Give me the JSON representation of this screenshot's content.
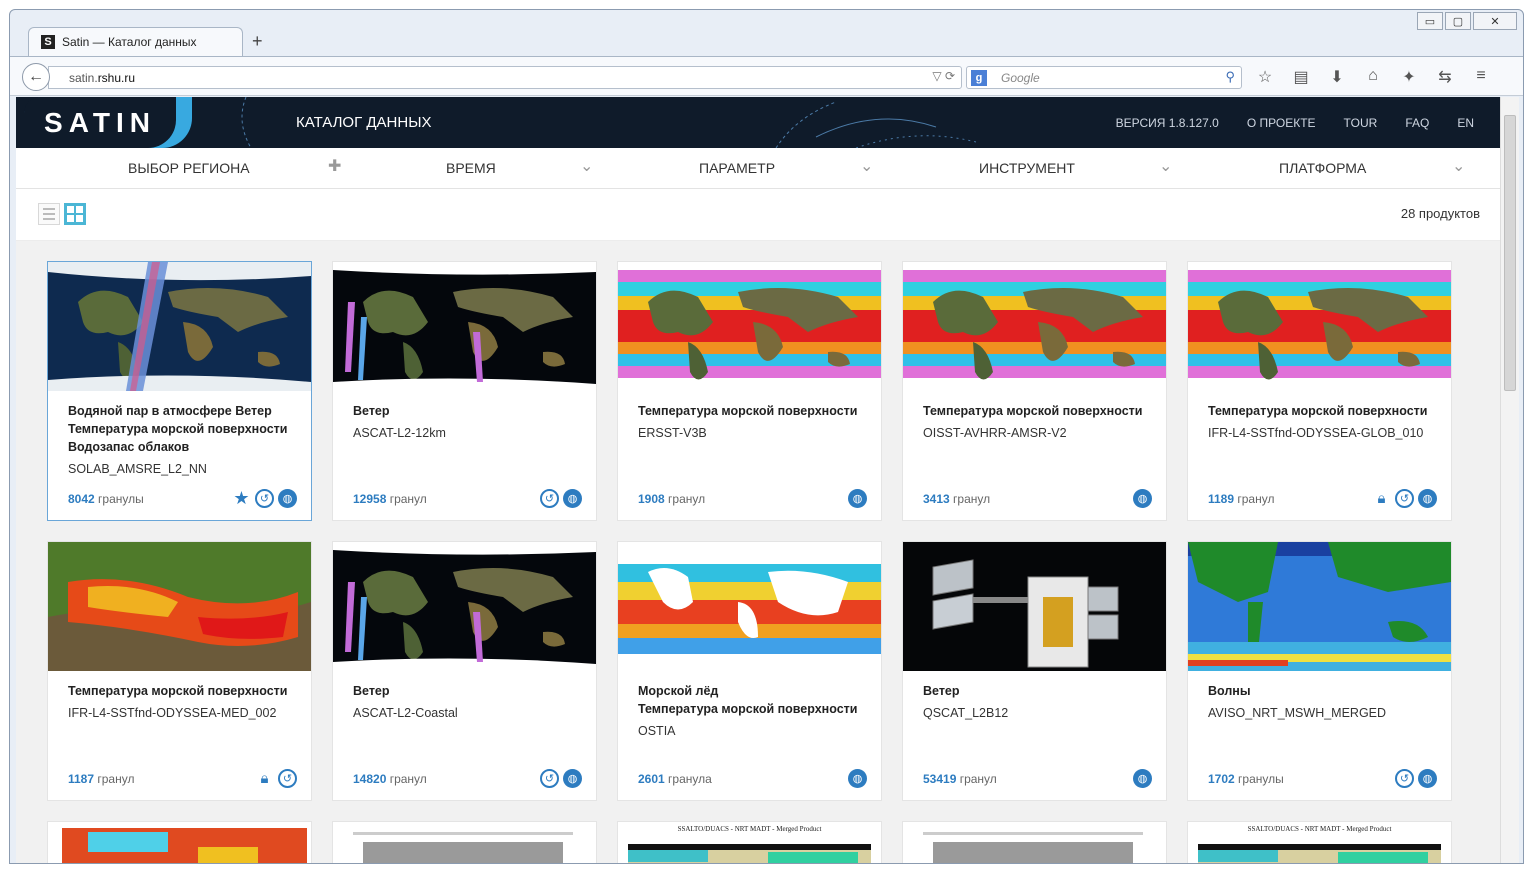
{
  "browser": {
    "tab_title": "Satin — Каталог данных",
    "tab_favicon": "S",
    "new_tab": "+",
    "url_prefix": "satin.",
    "url_domain": "rshu.ru",
    "search_placeholder": "Google",
    "search_engine": "g",
    "window_controls": [
      "▭",
      "▢",
      "✕"
    ],
    "toolbar_icons": [
      "star-icon",
      "bookmarks-icon",
      "download-icon",
      "home-icon",
      "addon-icon",
      "sync-icon",
      "menu-icon"
    ]
  },
  "header": {
    "logo": "SATIN",
    "catalog_title": "КАТАЛОГ ДАННЫХ",
    "nav": [
      "ВЕРСИЯ 1.8.127.0",
      "О ПРОЕКТЕ",
      "TOUR",
      "FAQ",
      "EN"
    ]
  },
  "filters": {
    "region": "ВЫБОР РЕГИОНА",
    "time": "ВРЕМЯ",
    "parameter": "ПАРАМЕТР",
    "instrument": "ИНСТРУМЕНТ",
    "platform": "ПЛАТФОРМА"
  },
  "toolbar": {
    "count": "28 продуктов"
  },
  "cards": [
    {
      "title": [
        "Водяной пар в атмосфере  Ветер",
        "Температура морской поверхности",
        "Водозапас облаков"
      ],
      "name": "SOLAB_AMSRE_L2_NN",
      "count": "8042",
      "unit": "гранулы",
      "icons": [
        "favorite-star-icon",
        "history-icon",
        "globe-icon"
      ],
      "image": "globe-swath"
    },
    {
      "title": [
        "Ветер"
      ],
      "name": "ASCAT-L2-12km",
      "count": "12958",
      "unit": "гранул",
      "icons": [
        "history-icon",
        "globe-icon"
      ],
      "image": "dark-swath"
    },
    {
      "title": [
        "Температура морской поверхности"
      ],
      "name": "ERSST-V3B",
      "count": "1908",
      "unit": "гранул",
      "icons": [
        "globe-icon"
      ],
      "image": "sst"
    },
    {
      "title": [
        "Температура морской поверхности"
      ],
      "name": "OISST-AVHRR-AMSR-V2",
      "count": "3413",
      "unit": "гранул",
      "icons": [
        "globe-icon"
      ],
      "image": "sst"
    },
    {
      "title": [
        "Температура морской поверхности"
      ],
      "name": "IFR-L4-SSTfnd-ODYSSEA-GLOB_010",
      "count": "1189",
      "unit": "гранул",
      "icons": [
        "lock-icon",
        "history-icon",
        "globe-icon"
      ],
      "image": "sst"
    },
    {
      "title": [
        "Температура морской поверхности"
      ],
      "name": "IFR-L4-SSTfnd-ODYSSEA-MED_002",
      "count": "1187",
      "unit": "гранул",
      "icons": [
        "lock-icon",
        "history-icon"
      ],
      "image": "med"
    },
    {
      "title": [
        "Ветер"
      ],
      "name": "ASCAT-L2-Coastal",
      "count": "14820",
      "unit": "гранул",
      "icons": [
        "history-icon",
        "globe-icon"
      ],
      "image": "dark-swath"
    },
    {
      "title": [
        "Морской лёд",
        "Температура морской поверхности"
      ],
      "name": "OSTIA",
      "count": "2601",
      "unit": "гранула",
      "icons": [
        "globe-icon"
      ],
      "image": "ostia"
    },
    {
      "title": [
        "Ветер"
      ],
      "name": "QSCAT_L2B12",
      "count": "53419",
      "unit": "гранул",
      "icons": [
        "globe-icon"
      ],
      "image": "satellite"
    },
    {
      "title": [
        "Волны"
      ],
      "name": "AVISO_NRT_MSWH_MERGED",
      "count": "1702",
      "unit": "гранулы",
      "icons": [
        "history-icon",
        "globe-icon"
      ],
      "image": "waves"
    }
  ],
  "partial_cards": [
    {
      "caption": "",
      "image": "map-red"
    },
    {
      "caption": "",
      "image": "grey-plot"
    },
    {
      "caption": "SSALTO/DUACS - NRT MADT - Merged Product",
      "image": "plot"
    },
    {
      "caption": "",
      "image": "grey-plot"
    },
    {
      "caption": "SSALTO/DUACS - NRT MADT - Merged Product",
      "image": "plot"
    }
  ],
  "colors": {
    "accent": "#2d7cc0",
    "header_bg": "#0f1b2a",
    "logo_blue": "#38a9e0",
    "grid_active": "#4bb6d5"
  }
}
